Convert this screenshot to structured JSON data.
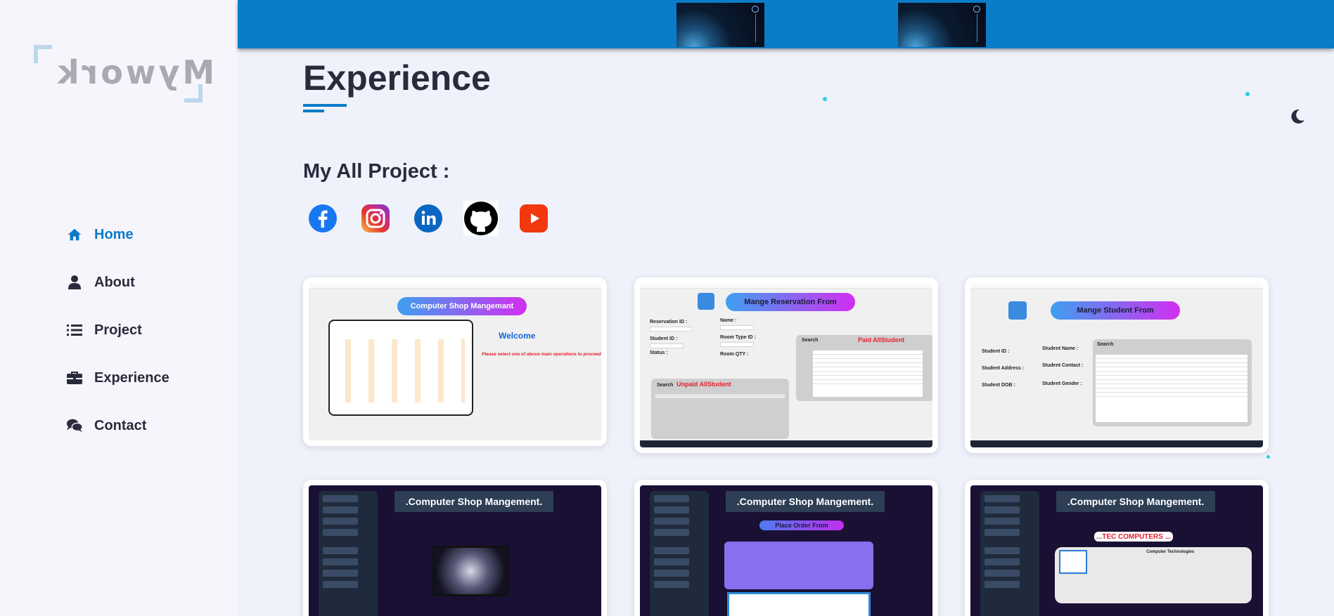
{
  "sidebar": {
    "logo_text": "Mywork",
    "items": [
      {
        "label": "Home",
        "icon": "home-icon",
        "active": true
      },
      {
        "label": "About",
        "icon": "user-icon",
        "active": false
      },
      {
        "label": "Project",
        "icon": "list-icon",
        "active": false
      },
      {
        "label": "Experience",
        "icon": "briefcase-icon",
        "active": false
      },
      {
        "label": "Contact",
        "icon": "chat-icon",
        "active": false
      }
    ]
  },
  "main": {
    "title": "Experience",
    "projects_heading": "My All Project :",
    "socials": [
      {
        "name": "facebook-icon",
        "color": "#1877f2"
      },
      {
        "name": "instagram-icon",
        "color": "#d6249f"
      },
      {
        "name": "linkedin-icon",
        "color": "#0a66c2"
      },
      {
        "name": "github-icon",
        "color": "#000000"
      },
      {
        "name": "youtube-icon",
        "color": "#ff0000"
      }
    ]
  },
  "projects": [
    {
      "title": "Computer Shop Mangemant",
      "subtitle": "Welcome",
      "message": "Please select one of above main operations to proceed"
    },
    {
      "title": "Mange Reservation From",
      "labels": [
        "Reservation ID :",
        "Name :",
        "Student ID :",
        "Room Type ID :",
        "Status :",
        "Room QTY :",
        "Search"
      ],
      "red_labels": [
        "Paid AllStudent",
        "Unpaid AllStudent"
      ]
    },
    {
      "title": "Mange Student From",
      "labels": [
        "Student ID :",
        "Student Name :",
        "Student Address :",
        "Student Contact :",
        "Student DOB :",
        "Student Gender :",
        "Search"
      ]
    },
    {
      "title": ".Computer Shop Mangement."
    },
    {
      "title": ".Computer Shop Mangement.",
      "subtitle": "Place Order From"
    },
    {
      "title": ".Computer Shop Mangement.",
      "subtitle": "...TEC COMPUTERS ...",
      "caption": "Computer Technologies"
    }
  ],
  "colors": {
    "accent": "#0a7cc8",
    "topbar": "#0a7cc8",
    "dot": "#1fd3e6"
  }
}
